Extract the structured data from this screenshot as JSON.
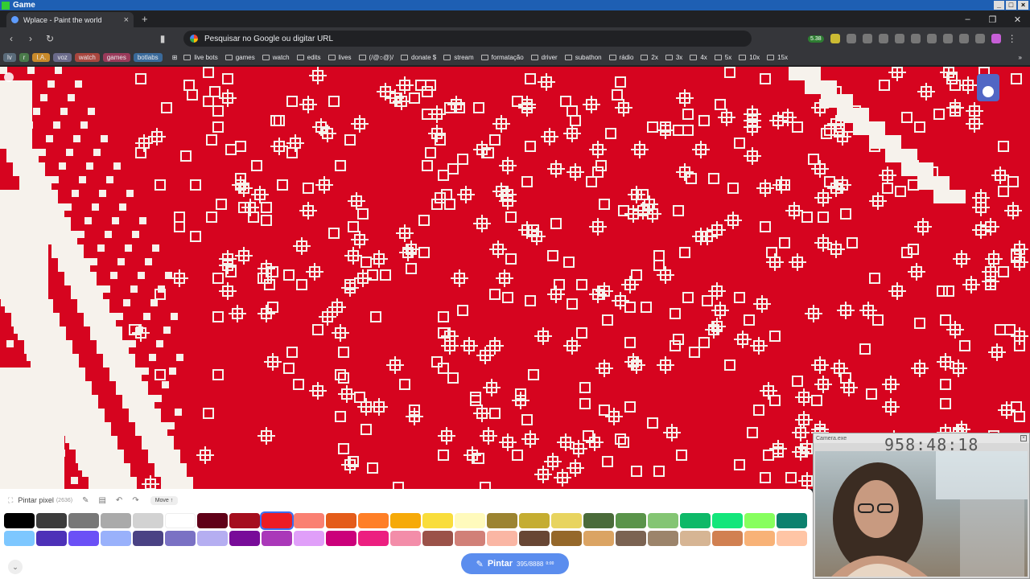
{
  "os": {
    "title": "Game"
  },
  "tab": {
    "title": "Wplace - Paint the world"
  },
  "address": {
    "placeholder": "Pesquisar no Google ou digitar URL"
  },
  "extensions": {
    "badge": "5.38"
  },
  "bookmarks": {
    "chips": [
      {
        "label": "lv",
        "color": "#5a6b7a"
      },
      {
        "label": "r",
        "color": "#4a7a4a"
      },
      {
        "label": "I.A.",
        "color": "#c88a2a"
      },
      {
        "label": "voz",
        "color": "#6a6a8a"
      },
      {
        "label": "watch",
        "color": "#a8463e"
      },
      {
        "label": "games",
        "color": "#9a3a5a"
      },
      {
        "label": "botlabs",
        "color": "#3a6a9a"
      }
    ],
    "items": [
      "live bots",
      "games",
      "watch",
      "edits",
      "lives",
      "(/@೦@)/",
      "donate $",
      "stream",
      "formatação",
      "driver",
      "subathon",
      "rádio",
      "2x",
      "3x",
      "4x",
      "5x",
      "10x",
      "15x"
    ]
  },
  "panel": {
    "title": "Pintar pixel",
    "count": "(2636)",
    "move_label": "Move ↑",
    "palette_row1": [
      "#000000",
      "#3c3c3c",
      "#787878",
      "#aaaaaa",
      "#d2d2d2",
      "#ffffff",
      "#600018",
      "#a50e1e",
      "#ed1c24",
      "#fa8072",
      "#e45c1a",
      "#ff7f27",
      "#f6aa09",
      "#f9dd3b",
      "#fffabc",
      "#9c8431",
      "#c5ad31",
      "#e8d45f",
      "#4a6b3a",
      "#5a944a",
      "#84c573",
      "#0eb968",
      "#13e67b",
      "#87ff5e",
      "#0c816e"
    ],
    "palette_row2": [
      "#7dc7ff",
      "#4d31b8",
      "#6b50f6",
      "#99b1fb",
      "#4a4284",
      "#7a71c4",
      "#b5aef1",
      "#780c99",
      "#aa38b9",
      "#e09ff9",
      "#cb007a",
      "#ec1f80",
      "#f38da9",
      "#9b5249",
      "#d18078",
      "#fab6a4",
      "#684634",
      "#95682a",
      "#dba463",
      "#7b6352",
      "#9c846b",
      "#d6b594",
      "#d18051",
      "#f8b277",
      "#ffc5a5"
    ],
    "selected_index": 8
  },
  "paint_button": {
    "label": "Pintar",
    "progress": "395/8888",
    "timer": "0:00"
  },
  "webcam": {
    "title": "Camera.exe",
    "timer": "958:48:18"
  }
}
